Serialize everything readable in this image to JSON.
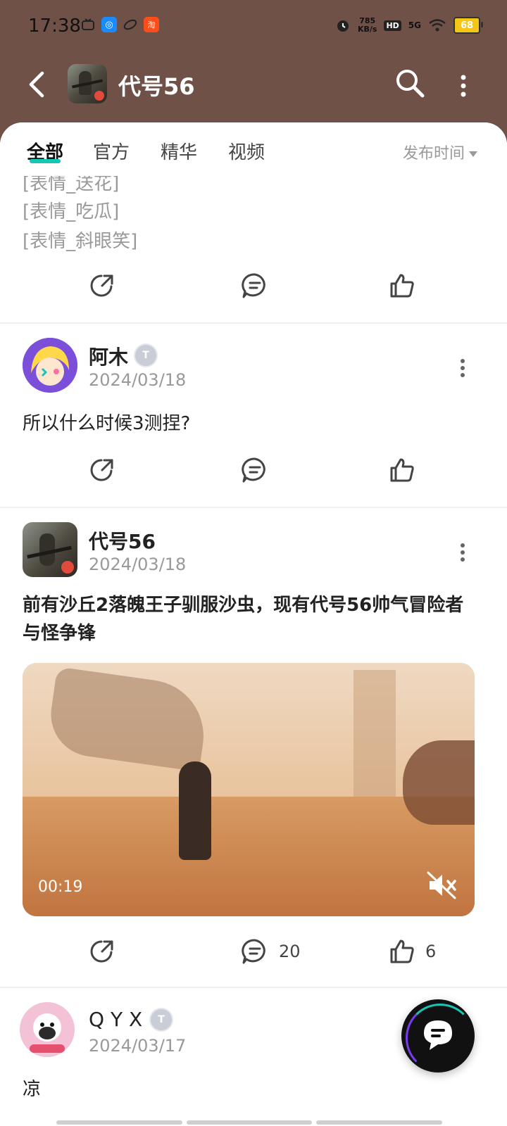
{
  "status_bar": {
    "time": "17:38",
    "net_speed_value": "785",
    "net_speed_unit": "KB/s",
    "network_label": "HD",
    "signal_label": "5G",
    "battery": "68"
  },
  "header": {
    "title": "代号56"
  },
  "tabs": [
    {
      "label": "全部",
      "active": true
    },
    {
      "label": "官方",
      "active": false
    },
    {
      "label": "精华",
      "active": false
    },
    {
      "label": "视频",
      "active": false
    }
  ],
  "sort_label": "发布时间",
  "feed": {
    "partial_post": {
      "lines": [
        "[表情_送花]",
        "[表情_吃瓜]",
        "[表情_斜眼笑]"
      ]
    },
    "posts": [
      {
        "user": "阿木",
        "badge": "T",
        "date": "2024/03/18",
        "text": "所以什么时候3测捏?",
        "comments": "",
        "likes": ""
      },
      {
        "user": "代号56",
        "date": "2024/03/18",
        "text": "前有沙丘2落魄王子驯服沙虫，现有代号56帅气冒险者与怪争锋",
        "video_duration": "00:19",
        "comments": "20",
        "likes": "6"
      },
      {
        "user": "Q Y X",
        "badge": "T",
        "date": "2024/03/17",
        "text": "凉"
      }
    ]
  },
  "colors": {
    "header_bg": "#6f5148",
    "accent": "#17c7b5"
  }
}
